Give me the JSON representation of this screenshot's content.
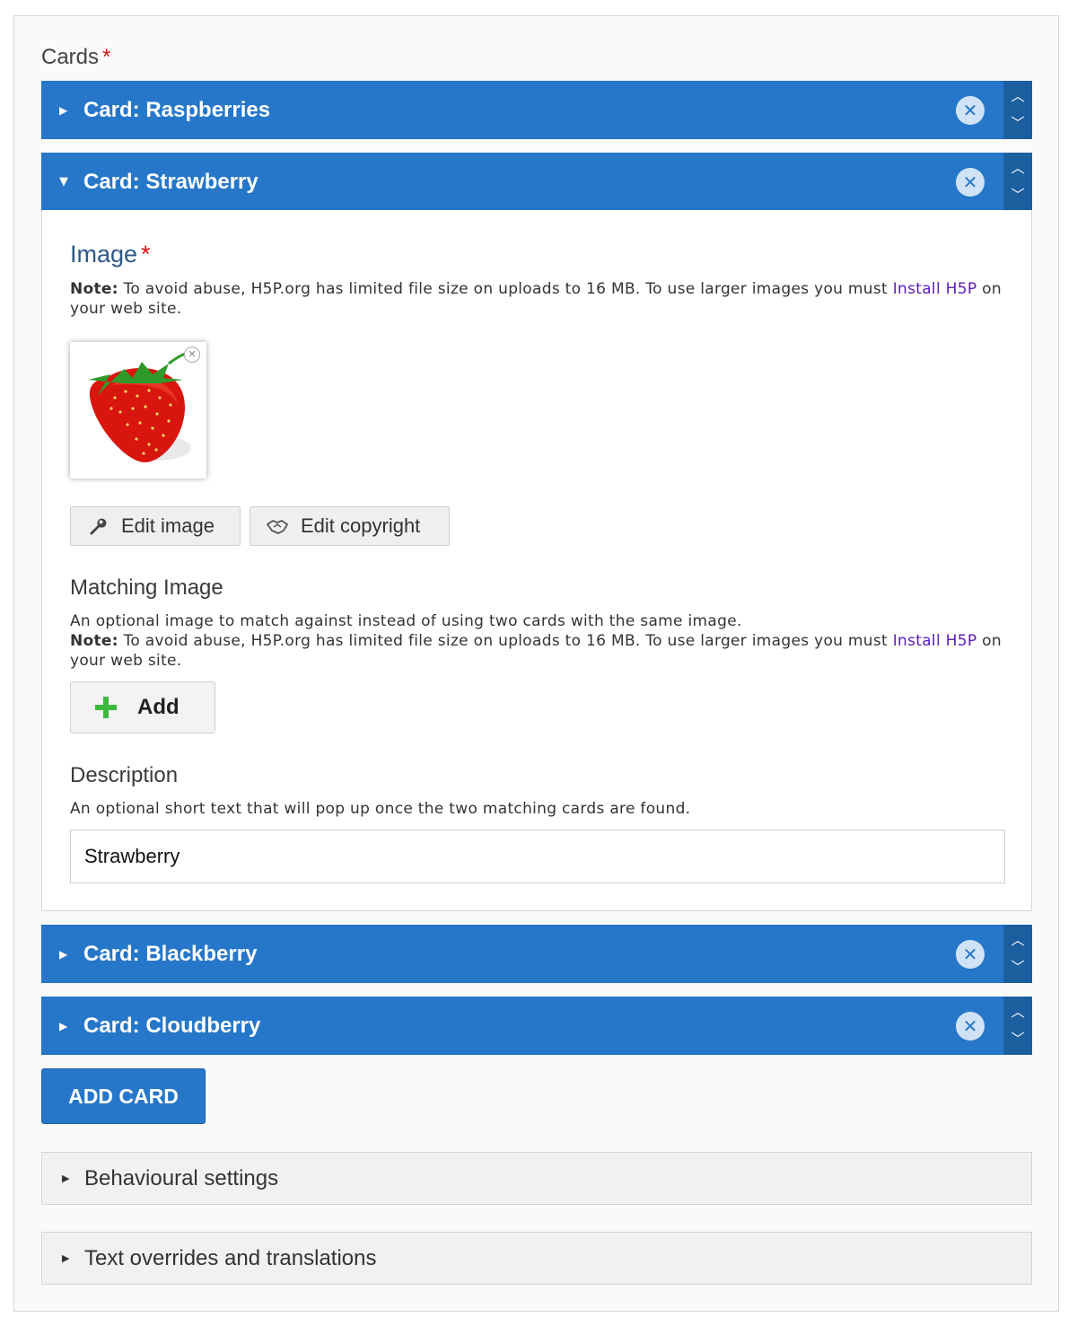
{
  "section": {
    "label": "Cards",
    "required_mark": "*"
  },
  "cards": [
    {
      "title": "Card: Raspberries",
      "expanded": false
    },
    {
      "title": "Card: Strawberry",
      "expanded": true
    },
    {
      "title": "Card: Blackberry",
      "expanded": false
    },
    {
      "title": "Card: Cloudberry",
      "expanded": false
    }
  ],
  "card_controls": {
    "remove_icon": "close-circle-icon",
    "move_up_icon": "chevron-up-icon",
    "move_down_icon": "chevron-down-icon"
  },
  "image_field": {
    "title": "Image",
    "required_mark": "*",
    "note_label": "Note:",
    "note_text": " To avoid abuse, H5P.org has limited file size on uploads to 16 MB. To use larger images you must ",
    "note_link": "Install H5P",
    "note_suffix": " on your web site.",
    "edit_image_label": "Edit image",
    "edit_copyright_label": "Edit copyright"
  },
  "matching_image": {
    "title": "Matching Image",
    "description": "An optional image to match against instead of using two cards with the same image.",
    "note_label": "Note:",
    "note_text": " To avoid abuse, H5P.org has limited file size on uploads to 16 MB. To use larger images you must ",
    "note_link": "Install H5P",
    "note_suffix": " on your web site.",
    "add_label": "Add"
  },
  "description_field": {
    "title": "Description",
    "help": "An optional short text that will pop up once the two matching cards are found.",
    "value": "Strawberry"
  },
  "add_card_label": "ADD CARD",
  "groups": [
    {
      "label": "Behavioural settings"
    },
    {
      "label": "Text overrides and translations"
    }
  ],
  "colors": {
    "header_blue": "#2677c9",
    "order_blue": "#1c5f9f",
    "required_red": "#dd1111",
    "link_purple": "#5c1bb6",
    "add_green": "#3cb93c"
  }
}
